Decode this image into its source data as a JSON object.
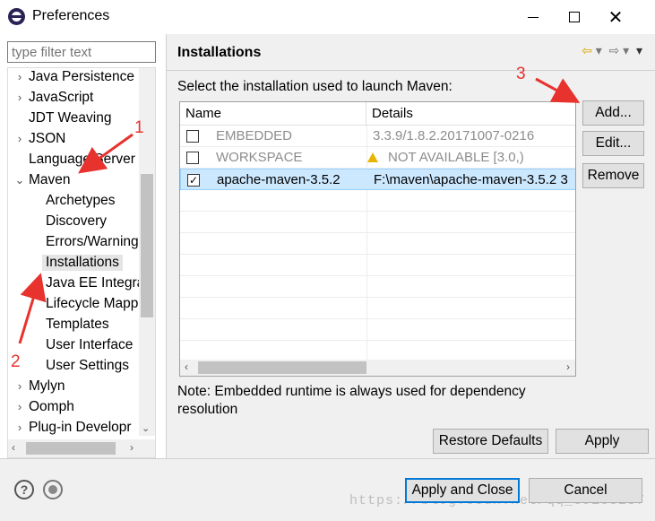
{
  "window": {
    "title": "Preferences"
  },
  "filter": {
    "placeholder": "type filter text"
  },
  "tree": [
    {
      "label": "Java Persistence",
      "arrow": "›",
      "indent": 0
    },
    {
      "label": "JavaScript",
      "arrow": "›",
      "indent": 0
    },
    {
      "label": "JDT Weaving",
      "arrow": "",
      "indent": 0
    },
    {
      "label": "JSON",
      "arrow": "›",
      "indent": 0
    },
    {
      "label": "Language Server",
      "arrow": "",
      "indent": 0
    },
    {
      "label": "Maven",
      "arrow": "⌄",
      "indent": 0
    },
    {
      "label": "Archetypes",
      "arrow": "",
      "indent": 1
    },
    {
      "label": "Discovery",
      "arrow": "",
      "indent": 1
    },
    {
      "label": "Errors/Warning",
      "arrow": "",
      "indent": 1
    },
    {
      "label": "Installations",
      "arrow": "",
      "indent": 1,
      "selected": true
    },
    {
      "label": "Java EE Integra",
      "arrow": "",
      "indent": 1
    },
    {
      "label": "Lifecycle Mapp",
      "arrow": "",
      "indent": 1
    },
    {
      "label": "Templates",
      "arrow": "",
      "indent": 1
    },
    {
      "label": "User Interface",
      "arrow": "",
      "indent": 1
    },
    {
      "label": "User Settings",
      "arrow": "",
      "indent": 1
    },
    {
      "label": "Mylyn",
      "arrow": "›",
      "indent": 0
    },
    {
      "label": "Oomph",
      "arrow": "›",
      "indent": 0
    },
    {
      "label": "Plug-in Developr",
      "arrow": "›",
      "indent": 0
    }
  ],
  "page": {
    "title": "Installations",
    "instruction": "Select the installation used to launch Maven:",
    "columns": {
      "name": "Name",
      "details": "Details"
    },
    "rows": [
      {
        "name": "EMBEDDED",
        "details": "3.3.9/1.8.2.20171007-0216",
        "checked": false,
        "muted": true
      },
      {
        "name": "WORKSPACE",
        "details": "NOT AVAILABLE [3.0,)",
        "checked": false,
        "muted": true,
        "warning": true
      },
      {
        "name": "apache-maven-3.5.2",
        "details": "F:\\maven\\apache-maven-3.5.2 3",
        "checked": true,
        "selected": true
      }
    ],
    "buttons": {
      "add": "Add...",
      "edit": "Edit...",
      "remove": "Remove"
    },
    "note": "Note: Embedded runtime is always used for dependency resolution",
    "restore_defaults": "Restore Defaults",
    "apply": "Apply"
  },
  "footer": {
    "apply_and_close": "Apply and Close",
    "cancel": "Cancel",
    "watermark": "https://blog.csdn.net/qq_39135287"
  },
  "annotations": {
    "one": "1",
    "two": "2",
    "three": "3"
  },
  "colors": {
    "annotation": "#e8322e",
    "selection": "#cce8ff",
    "focus": "#0078d7"
  }
}
